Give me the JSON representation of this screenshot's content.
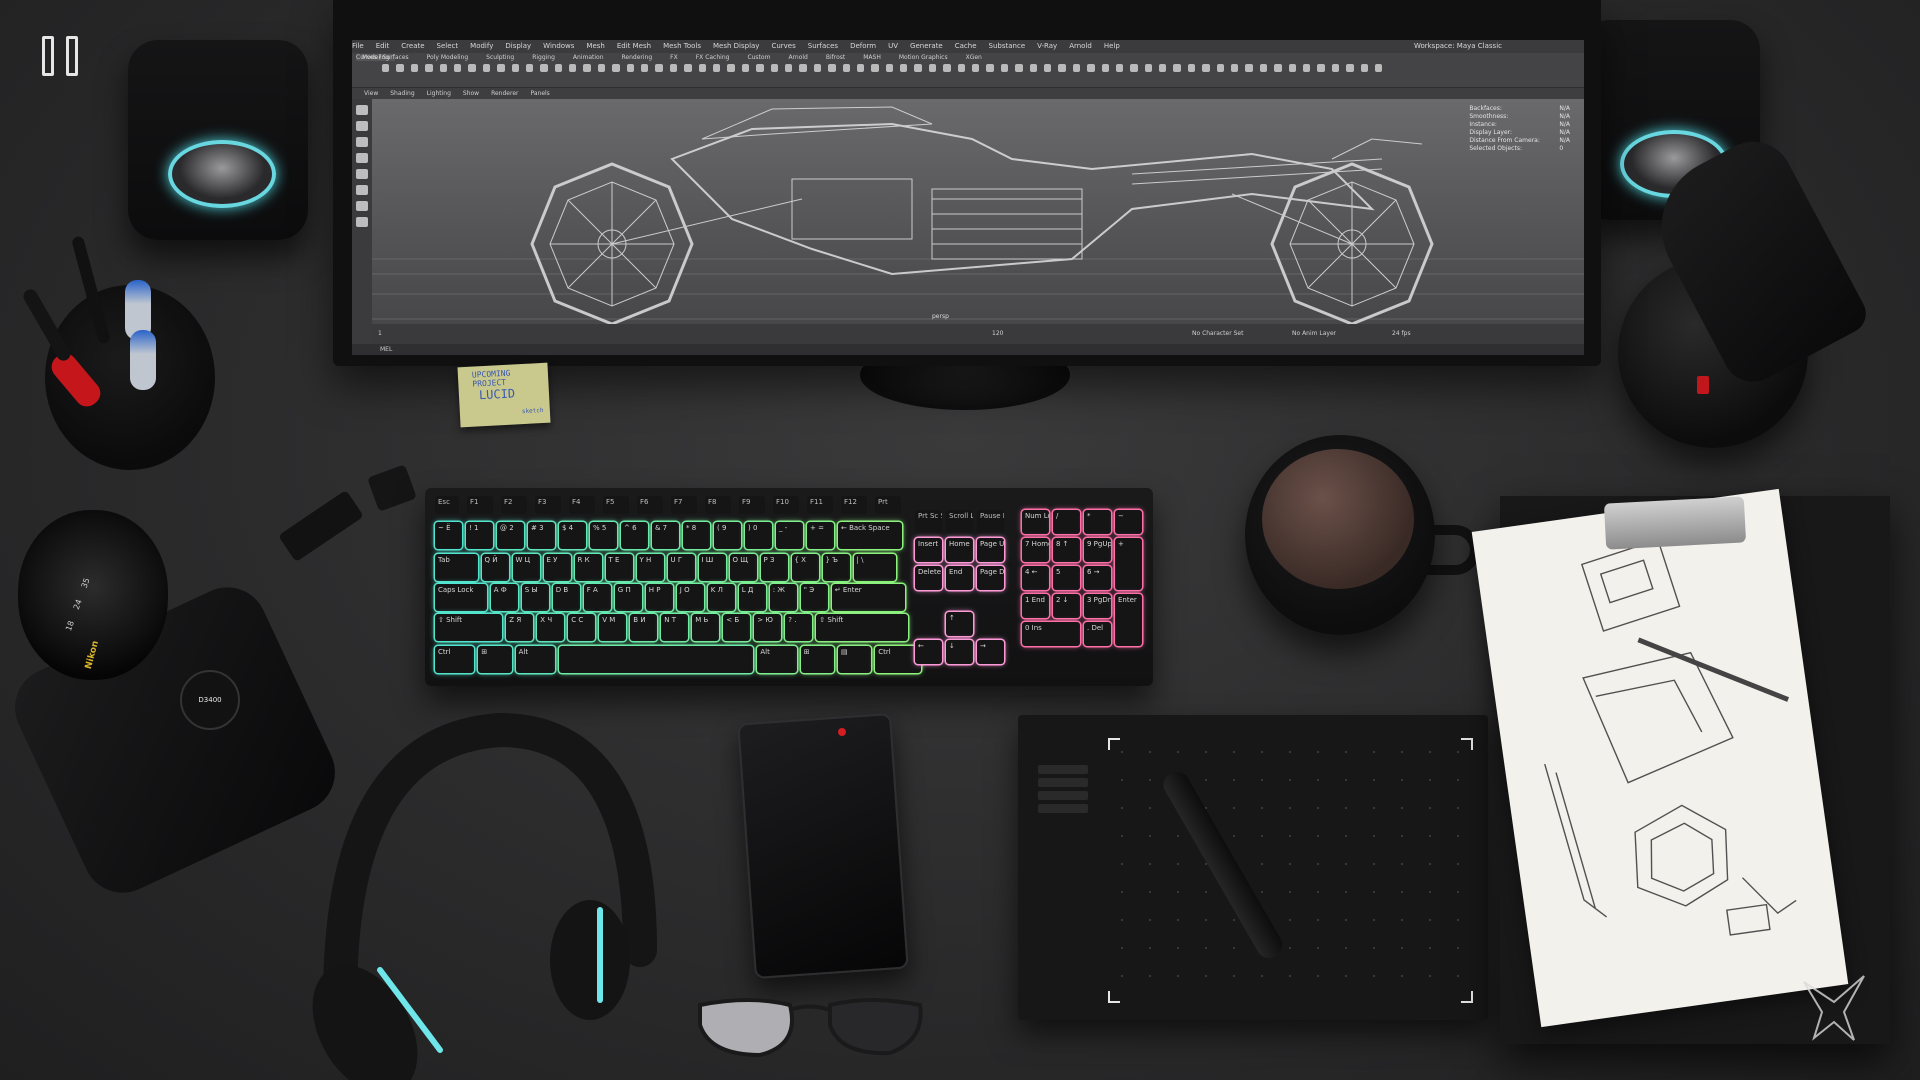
{
  "hud": {
    "pause_icon": "pause-icon"
  },
  "monitor": {
    "app_menu": [
      "File",
      "Edit",
      "Create",
      "Select",
      "Modify",
      "Display",
      "Windows",
      "Mesh",
      "Edit Mesh",
      "Mesh Tools",
      "Mesh Display",
      "Curves",
      "Surfaces",
      "Deform",
      "UV",
      "Generate",
      "Cache",
      "Substance",
      "V-Ray",
      "Arnold",
      "Help"
    ],
    "workspace_label": "Workspace: Maya Classic",
    "mode_selector": "Modeling",
    "shelf_tabs": [
      "Curves / Surfaces",
      "Poly Modeling",
      "Sculpting",
      "Rigging",
      "Animation",
      "Rendering",
      "FX",
      "FX Caching",
      "Custom",
      "Arnold",
      "Bifrost",
      "MASH",
      "Motion Graphics",
      "XGen"
    ],
    "panel_menu": [
      "View",
      "Shading",
      "Lighting",
      "Show",
      "Renderer",
      "Panels"
    ],
    "viewport_camera": "persp",
    "hud_stats": [
      {
        "label": "Backfaces:",
        "value": "N/A"
      },
      {
        "label": "Smoothness:",
        "value": "N/A"
      },
      {
        "label": "Instance:",
        "value": "N/A"
      },
      {
        "label": "Display Layer:",
        "value": "N/A"
      },
      {
        "label": "Distance From Camera:",
        "value": "N/A"
      },
      {
        "label": "Selected Objects:",
        "value": "0"
      }
    ],
    "timeline_left": "1",
    "timeline_right": "120",
    "character_set": "No Character Set",
    "anim_layer": "No Anim Layer",
    "fps": "24 fps",
    "command_label": "MEL"
  },
  "sticky_note": {
    "line1": "UPCOMING PROJECT",
    "line2": "LUCID",
    "line3": "sketch"
  },
  "keyboard": {
    "fn_row": [
      "Esc",
      "F1",
      "F2",
      "F3",
      "F4",
      "F5",
      "F6",
      "F7",
      "F8",
      "F9",
      "F10",
      "F11",
      "F12",
      "Prt"
    ],
    "num_row": [
      "~ Ё",
      "! 1",
      "@ 2",
      "# 3",
      "$ 4",
      "% 5",
      "^ 6",
      "& 7",
      "* 8",
      "( 9",
      ") 0",
      "_ -",
      "+ =",
      "← Back Space"
    ],
    "q_row": [
      "Tab",
      "Q Й",
      "W Ц",
      "E У",
      "R К",
      "T Е",
      "Y Н",
      "U Г",
      "I Ш",
      "O Щ",
      "P З",
      "{ Х",
      "} Ъ",
      "| \\"
    ],
    "a_row": [
      "Caps Lock",
      "A Ф",
      "S Ы",
      "D В",
      "F А",
      "G П",
      "H Р",
      "J О",
      "K Л",
      "L Д",
      ": Ж",
      "\" Э",
      "↵ Enter"
    ],
    "z_row": [
      "⇧ Shift",
      "Z Я",
      "X Ч",
      "C С",
      "V М",
      "B И",
      "N Т",
      "M Ь",
      "< Б",
      "> Ю",
      "? .",
      "⇧ Shift"
    ],
    "bottom_row": [
      "Ctrl",
      "⊞",
      "Alt",
      "",
      "Alt",
      "⊞",
      "▤",
      "Ctrl"
    ],
    "nav_keys": [
      "Prt Sc SysRq",
      "Scroll Lock",
      "Pause Break",
      "Insert",
      "Home",
      "Page Up",
      "Delete",
      "End",
      "Page Down",
      "↑",
      "←",
      "↓",
      "→"
    ],
    "numpad_keys": [
      "Num Lock",
      "/",
      "*",
      "−",
      "7 Home",
      "8 ↑",
      "9 PgUp",
      "+",
      "4 ←",
      "5",
      "6 →",
      "1 End",
      "2 ↓",
      "3 PgDn",
      "Enter",
      "0 Ins",
      ". Del"
    ],
    "colors": {
      "left": "#4fe3d2",
      "mid": "#8ef27a",
      "right": "#ff6fa8"
    }
  },
  "camera": {
    "brand": "Nikon",
    "model": "D3400",
    "lens_marks": [
      "18",
      "24",
      "35"
    ]
  },
  "watermark": {
    "icon": "studio-logo-icon"
  }
}
